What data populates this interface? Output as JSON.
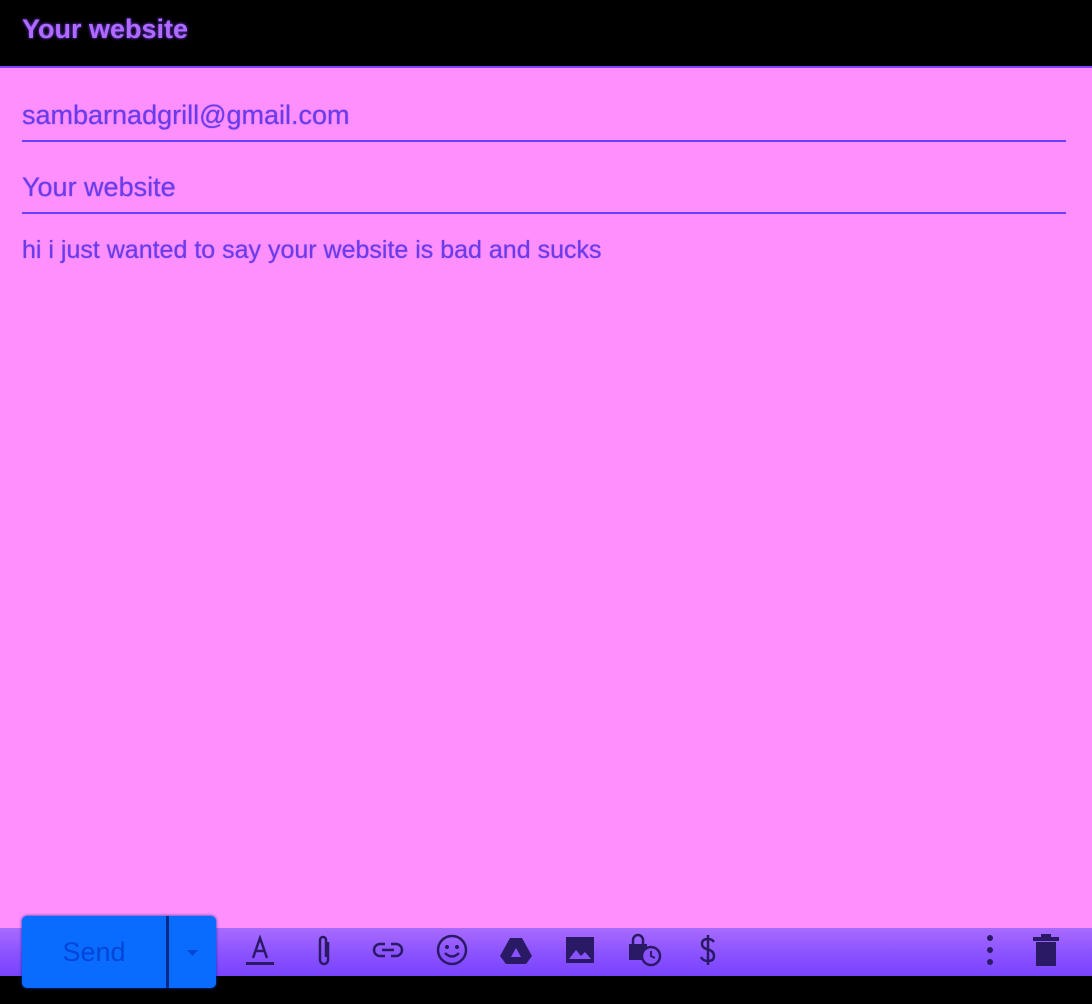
{
  "header": {
    "title": "Your website"
  },
  "compose": {
    "to": "sambarnadgrill@gmail.com",
    "subject": "Your website",
    "body": "hi i just wanted to say your website is bad and sucks"
  },
  "toolbar": {
    "send_label": "Send",
    "icons": [
      "send-options-icon",
      "formatting-icon",
      "attach-file-icon",
      "insert-link-icon",
      "insert-emoji-icon",
      "insert-drive-icon",
      "insert-photo-icon",
      "confidential-mode-icon",
      "insert-money-icon",
      "more-options-icon",
      "discard-draft-icon"
    ]
  },
  "colors": {
    "background": "#ff8ffc",
    "text": "#6a3ce8",
    "header_bg": "#000000",
    "header_text": "#b06aff",
    "accent": "#7b44ff",
    "send_button": "#0a6bff"
  }
}
